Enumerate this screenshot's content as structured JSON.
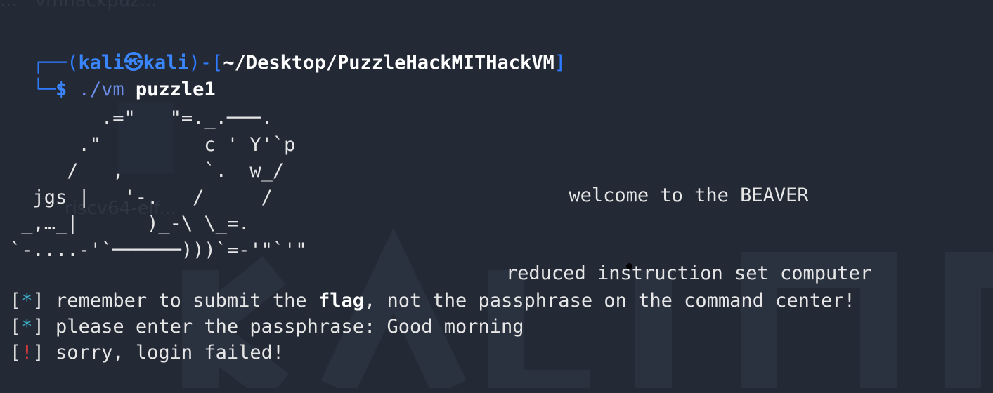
{
  "wallpaper": {
    "file_label_top": "...   vmhackpuz...",
    "file_label_mid": "riscv64-elf..."
  },
  "prompt": {
    "corner_top": "┌──(",
    "user": "kali",
    "at_symbol": "㉿",
    "host": "kali",
    "close_paren_open_bracket": ")-[",
    "cwd": "~/Desktop/PuzzleHackMITHackVM",
    "close_bracket": "]",
    "corner_bottom": "└─",
    "dollar": "$",
    "command": "./vm",
    "argument": "puzzle1"
  },
  "ascii_art": "        .=\"   \"=._.───.\n      .\"         c ' Y'`p\n     /   ,       `.  w_/\n  jgs |   '-.   /     /\n _,…_|      )_-\\ \\_=.\n`-....-'`──────)))`=-'\"`'\"",
  "banner": {
    "line1": "welcome to the BEAVER",
    "line2": "reduced instruction set computer"
  },
  "output": {
    "line1_marker": "*",
    "line1_before": " remember to submit the ",
    "line1_bold": "flag",
    "line1_after": ", not the passphrase on the command center!",
    "line2_marker": "*",
    "line2_text": " please enter the passphrase: Good morning",
    "line3_marker": "!",
    "line3_text": " sorry, login failed!"
  }
}
